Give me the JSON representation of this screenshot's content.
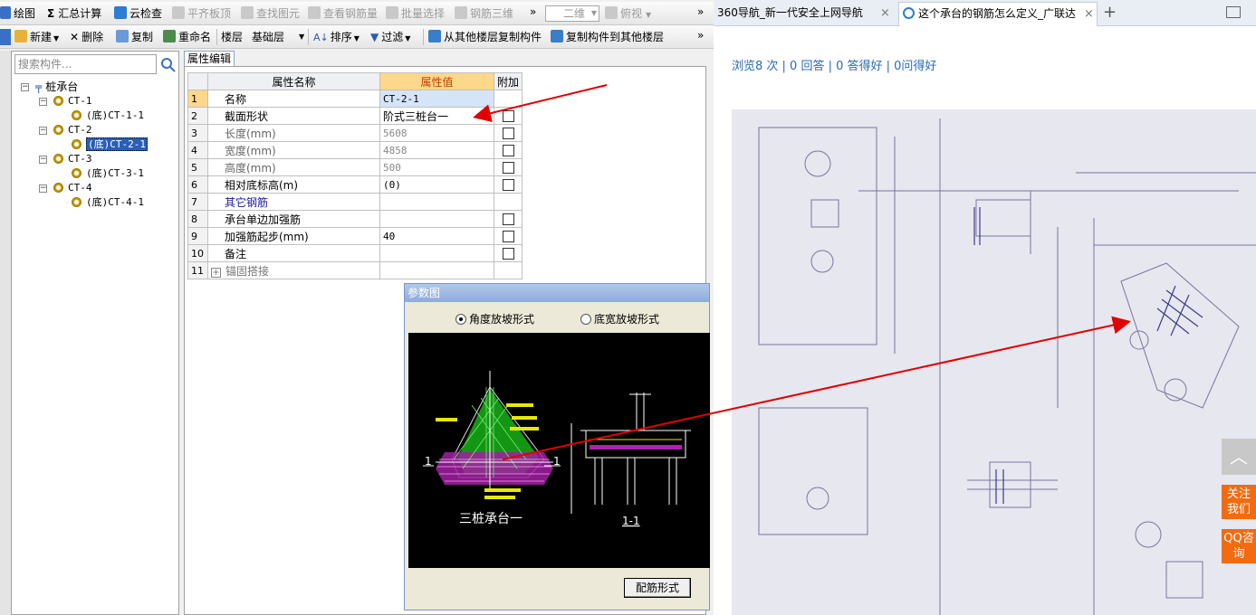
{
  "toolbar1": {
    "draw": "绘图",
    "sum_icon": "Σ",
    "calc": "汇总计算",
    "cloud_check": "云检查",
    "flush_slab": "平齐板顶",
    "find_element": "查找图元",
    "view_rebar": "查看钢筋量",
    "batch_select": "批量选择",
    "rebar_3d": "钢筋三维",
    "view_mode": "二维",
    "view_angle": "俯视",
    "more": "»"
  },
  "toolbar2": {
    "new": "新建",
    "delete": "删除",
    "copy": "复制",
    "rename": "重命名",
    "floor_label": "楼层",
    "floor_value": "基础层",
    "sort": "排序",
    "filter": "过滤",
    "copy_from_other": "从其他楼层复制构件",
    "copy_to_other": "复制构件到其他楼层",
    "more": "»"
  },
  "tree": {
    "search_placeholder": "搜索构件...",
    "root": "桩承台",
    "nodes": [
      {
        "label": "CT-1",
        "child": "(底)CT-1-1"
      },
      {
        "label": "CT-2",
        "child": "(底)CT-2-1"
      },
      {
        "label": "CT-3",
        "child": "(底)CT-3-1"
      },
      {
        "label": "CT-4",
        "child": "(底)CT-4-1"
      }
    ]
  },
  "props": {
    "tab": "属性编辑",
    "headers": {
      "name": "属性名称",
      "value": "属性值",
      "extra": "附加"
    },
    "rows": [
      {
        "idx": "1",
        "name": "名称",
        "value": "CT-2-1"
      },
      {
        "idx": "2",
        "name": "截面形状",
        "value": "阶式三桩台一"
      },
      {
        "idx": "3",
        "name": "长度(mm)",
        "value": "5608"
      },
      {
        "idx": "4",
        "name": "宽度(mm)",
        "value": "4858"
      },
      {
        "idx": "5",
        "name": "高度(mm)",
        "value": "500"
      },
      {
        "idx": "6",
        "name": "相对底标高(m)",
        "value": "(0)"
      },
      {
        "idx": "7",
        "name": "其它钢筋",
        "value": ""
      },
      {
        "idx": "8",
        "name": "承台单边加强筋",
        "value": ""
      },
      {
        "idx": "9",
        "name": "加强筋起步(mm)",
        "value": "40"
      },
      {
        "idx": "10",
        "name": "备注",
        "value": ""
      },
      {
        "idx": "11",
        "name": "锚固搭接",
        "value": ""
      }
    ]
  },
  "param_dialog": {
    "title": "参数图",
    "radio_angle": "角度放坡形式",
    "radio_width": "底宽放坡形式",
    "caption_main": "三桩承台一",
    "caption_section": "1-1",
    "section_mark": "1",
    "button": "配筋形式"
  },
  "browser": {
    "tab1": "360导航_新一代安全上网导航",
    "tab2": "这个承台的钢筋怎么定义_广联达",
    "close": "×",
    "new_tab": "+",
    "stats": "浏览8 次 | 0 回答 | 0 答得好 | 0问得好",
    "back_to_top": "︿",
    "follow": "关注我们",
    "qq": "QQ咨询"
  },
  "colors": {
    "accent_orange": "#f26b10",
    "link_blue": "#2a6ab3",
    "annotation_red": "#e00000"
  }
}
